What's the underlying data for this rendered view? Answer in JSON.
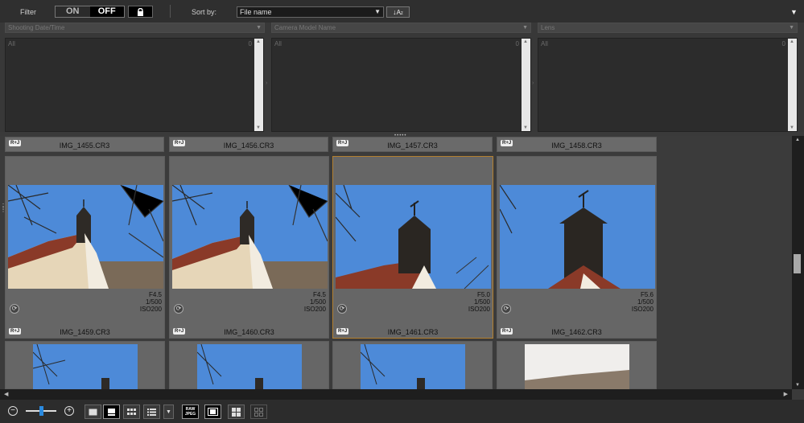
{
  "toolbar": {
    "filter_label": "Filter",
    "on_label": "ON",
    "off_label": "OFF",
    "lock_icon": "lock-icon",
    "sort_label": "Sort by:",
    "sort_value": "File name",
    "sort_order_label": "↓A↓z"
  },
  "filter_columns": [
    {
      "header": "Shooting Date/Time",
      "all_label": "All",
      "count": "0"
    },
    {
      "header": "Camera Model Name",
      "all_label": "All",
      "count": "0"
    },
    {
      "header": "Lens",
      "all_label": "All",
      "count": "0"
    }
  ],
  "top_row_names": [
    "IMG_1455.CR3",
    "IMG_1456.CR3",
    "IMG_1457.CR3",
    "IMG_1458.CR3"
  ],
  "main_row": [
    {
      "name": "IMG_1459.CR3",
      "aperture": "F4.5",
      "shutter": "1/500",
      "iso": "ISO200"
    },
    {
      "name": "IMG_1460.CR3",
      "aperture": "F4.5",
      "shutter": "1/500",
      "iso": "ISO200"
    },
    {
      "name": "IMG_1461.CR3",
      "aperture": "F5.0",
      "shutter": "1/500",
      "iso": "ISO200"
    },
    {
      "name": "IMG_1462.CR3",
      "aperture": "F5.6",
      "shutter": "1/500",
      "iso": "ISO200"
    }
  ],
  "raw_jpeg_badge": "R+J",
  "raw_jpeg_button": {
    "line1": "RAW",
    "line2": "JPEG"
  },
  "colors": {
    "selection": "#b3802f",
    "sky": "#4d8ad8",
    "slider": "#2a8adf"
  }
}
